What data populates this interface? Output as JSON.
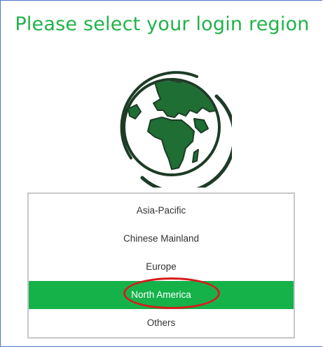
{
  "page": {
    "title": "Please select your login region"
  },
  "globe_icon": "earth-globe-icon",
  "colors": {
    "title_green": "#21b24a",
    "selected_green": "#15b24a",
    "globe_green": "#1f6e34",
    "highlight_red": "#d61c1c",
    "frame_border": "#4a79c9"
  },
  "regions": {
    "items": [
      {
        "label": "Asia-Pacific",
        "selected": false
      },
      {
        "label": "Chinese Mainland",
        "selected": false
      },
      {
        "label": "Europe",
        "selected": false
      },
      {
        "label": "North America",
        "selected": true
      },
      {
        "label": "Others",
        "selected": false
      }
    ]
  }
}
